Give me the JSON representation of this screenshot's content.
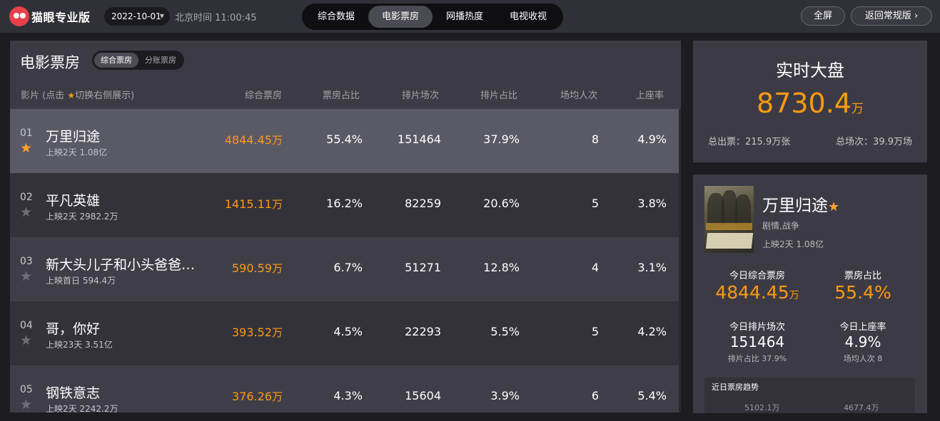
{
  "header": {
    "brand": "猫眼专业版",
    "date": "2022-10-01",
    "beijing_time": "北京时间 11:00:45",
    "tabs": [
      {
        "label": "综合数据",
        "active": false
      },
      {
        "label": "电影票房",
        "active": true
      },
      {
        "label": "网播热度",
        "active": false
      },
      {
        "label": "电视收视",
        "active": false
      }
    ],
    "fullscreen_label": "全屏",
    "back_label": "返回常规版 ›",
    "colors": {
      "brand_red": "#e8404a",
      "accent_orange": "#ff9a11"
    }
  },
  "boxoffice": {
    "title": "电影票房",
    "segments": [
      "综合票房",
      "分账票房"
    ],
    "active_segment": "综合票房",
    "columns": {
      "film_prefix": "影片 (点击",
      "film_suffix": "切换右侧展示)",
      "boxoffice": "综合票房",
      "share": "票房占比",
      "shows": "排片场次",
      "show_share": "排片占比",
      "avg_people": "场均人次",
      "occupancy": "上座率"
    },
    "rows": [
      {
        "rank": "01",
        "name": "万里归途",
        "sub": "上映2天  1.08亿",
        "bo": "4844.45",
        "bo_unit": "万",
        "share": "55.4%",
        "shows": "151464",
        "show_share": "37.9%",
        "avg": "8",
        "occ": "4.9%",
        "starred": true
      },
      {
        "rank": "02",
        "name": "平凡英雄",
        "sub": "上映2天  2982.2万",
        "bo": "1415.11",
        "bo_unit": "万",
        "share": "16.2%",
        "shows": "82259",
        "show_share": "20.6%",
        "avg": "5",
        "occ": "3.8%",
        "starred": false
      },
      {
        "rank": "03",
        "name": "新大头儿子和小头爸爸…",
        "sub": "上映首日  594.4万",
        "bo": "590.59",
        "bo_unit": "万",
        "share": "6.7%",
        "shows": "51271",
        "show_share": "12.8%",
        "avg": "4",
        "occ": "3.1%",
        "starred": false
      },
      {
        "rank": "04",
        "name": "哥，你好",
        "sub": "上映23天  3.51亿",
        "bo": "393.52",
        "bo_unit": "万",
        "share": "4.5%",
        "shows": "22293",
        "show_share": "5.5%",
        "avg": "5",
        "occ": "4.2%",
        "starred": false
      },
      {
        "rank": "05",
        "name": "钢铁意志",
        "sub": "上映2天  2242.2万",
        "bo": "376.26",
        "bo_unit": "万",
        "share": "4.3%",
        "shows": "15604",
        "show_share": "3.9%",
        "avg": "6",
        "occ": "5.4%",
        "starred": false
      }
    ]
  },
  "realtime": {
    "title": "实时大盘",
    "value": "8730.4",
    "unit": "万",
    "tickets": "总出票：215.9万张",
    "sessions": "总场次：39.9万场"
  },
  "detail": {
    "name": "万里归途",
    "genre": "剧情,战争",
    "release": "上映2天  1.08亿",
    "bo_label": "今日综合票房",
    "bo_value": "4844.45",
    "bo_unit": "万",
    "share_label": "票房占比",
    "share_value": "55.4%",
    "shows_label": "今日排片场次",
    "shows_value": "151464",
    "shows_sub": "排片占比 37.9%",
    "occ_label": "今日上座率",
    "occ_value": "4.9%",
    "occ_sub": "场均人次 8",
    "trend_title": "近日票房趋势",
    "trend_values": [
      "5102.1万",
      "4677.4万"
    ]
  }
}
